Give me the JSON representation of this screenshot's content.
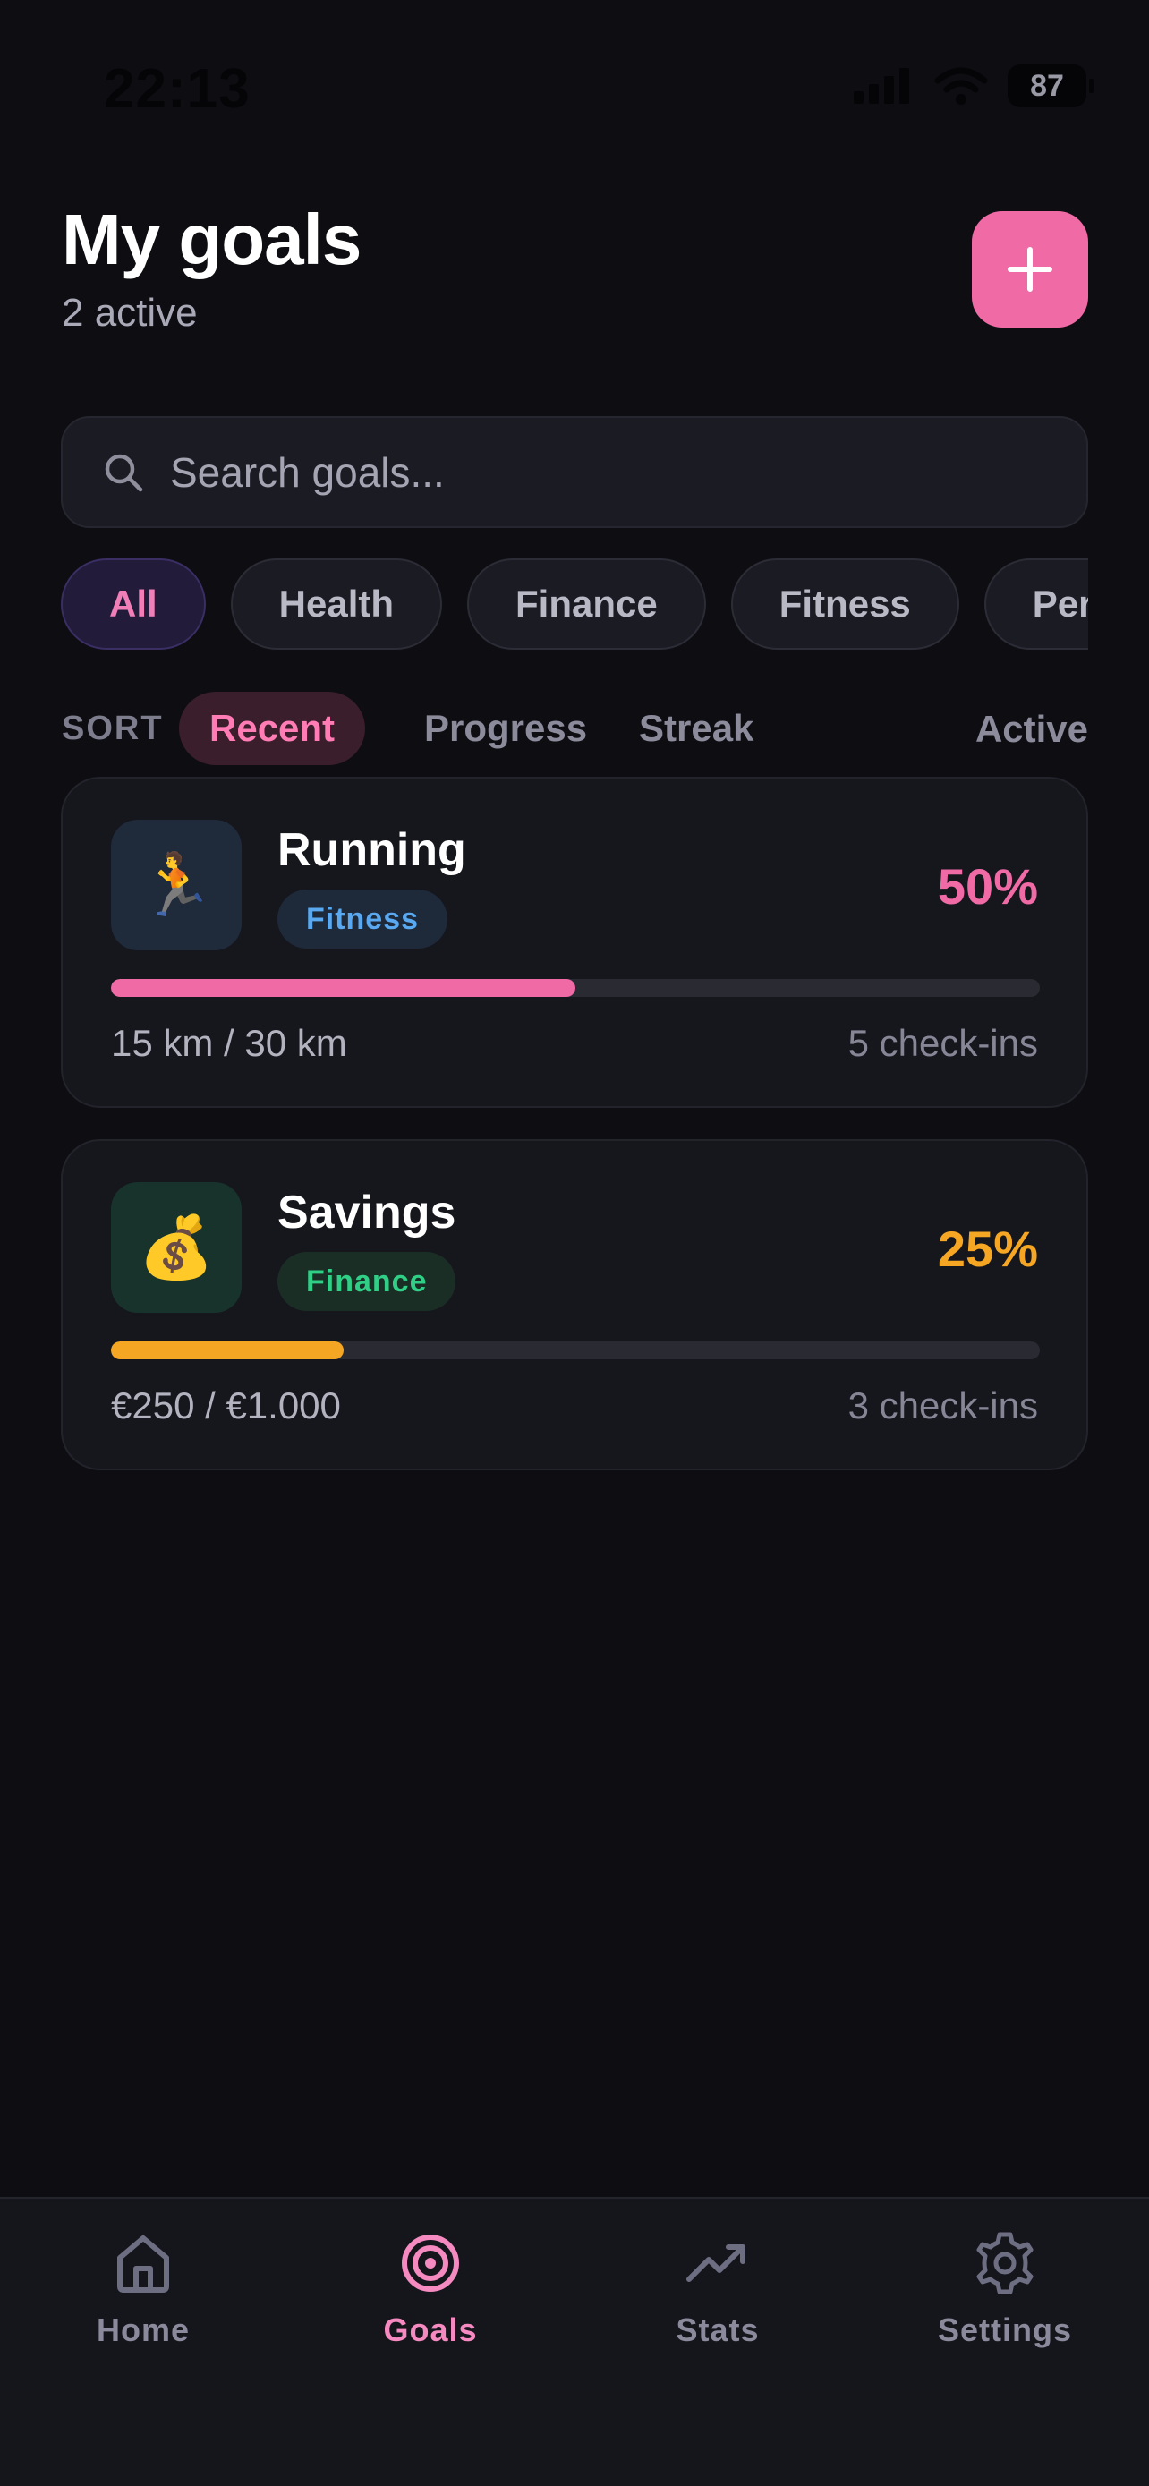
{
  "status_bar": {
    "time": "22:13",
    "battery": "87"
  },
  "header": {
    "title": "My goals",
    "subtitle": "2 active",
    "add_icon": "plus-icon"
  },
  "search": {
    "placeholder": "Search goals...",
    "value": "",
    "icon": "search-icon"
  },
  "categories": [
    {
      "label": "All",
      "active": true
    },
    {
      "label": "Health",
      "active": false
    },
    {
      "label": "Finance",
      "active": false
    },
    {
      "label": "Fitness",
      "active": false
    },
    {
      "label": "Personal",
      "active": false
    }
  ],
  "sort": {
    "label": "SORT",
    "options": [
      {
        "label": "Recent",
        "active": true
      },
      {
        "label": "Progress",
        "active": false
      },
      {
        "label": "Streak",
        "active": false
      }
    ],
    "filter_label": "Active"
  },
  "goals": [
    {
      "emoji": "🏃",
      "name": "Running",
      "tag": "Fitness",
      "percent": "50%",
      "progress": 0.5,
      "amount": "15 km / 30 km",
      "checkins": "5 check-ins",
      "accent_color": "#f06aa6",
      "tag_color": "#5aa9f0",
      "tag_bg": "#1e2a3a",
      "icon_bg": "#1f2a3a"
    },
    {
      "emoji": "💰",
      "name": "Savings",
      "tag": "Finance",
      "percent": "25%",
      "progress": 0.25,
      "amount": "€250 / €1.000",
      "checkins": "3 check-ins",
      "accent_color": "#f5a623",
      "tag_color": "#2fcf86",
      "tag_bg": "#1a2e26",
      "icon_bg": "#17332b"
    }
  ],
  "nav": [
    {
      "label": "Home",
      "icon": "home-icon",
      "active": false
    },
    {
      "label": "Goals",
      "icon": "target-icon",
      "active": true
    },
    {
      "label": "Stats",
      "icon": "trending-up-icon",
      "active": false
    },
    {
      "label": "Settings",
      "icon": "gear-icon",
      "active": false
    }
  ],
  "colors": {
    "accent": "#f06aa6",
    "background": "#0d0d12",
    "card": "#16161d"
  }
}
